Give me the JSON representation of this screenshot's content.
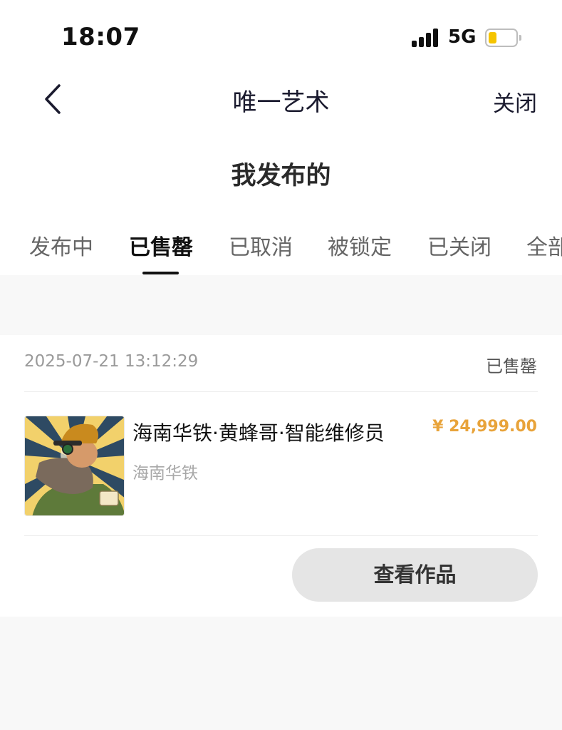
{
  "status_bar": {
    "time": "18:07",
    "network": "5G",
    "icons": [
      "cellular-signal-icon",
      "battery-icon"
    ],
    "battery_color": "#f5c400"
  },
  "nav": {
    "back_icon": "chevron-left-icon",
    "title": "唯一艺术",
    "close_label": "关闭"
  },
  "page": {
    "title": "我发布的"
  },
  "tabs": [
    {
      "label": "发布中",
      "active": false
    },
    {
      "label": "已售罄",
      "active": true
    },
    {
      "label": "已取消",
      "active": false
    },
    {
      "label": "被锁定",
      "active": false
    },
    {
      "label": "已关闭",
      "active": false
    },
    {
      "label": "全部",
      "active": false
    }
  ],
  "order": {
    "datetime": "2025-07-21 13:12:29",
    "status": "已售罄",
    "item": {
      "image": "bearded-worker-artwork-thumbnail",
      "title": "海南华铁·黄蜂哥·智能维修员",
      "subtitle": "海南华铁",
      "price": "¥ 24,999.00"
    },
    "view_button": "查看作品"
  },
  "colors": {
    "price": "#e8a33a",
    "active_tab": "#111111",
    "background": "#f8f8f8"
  }
}
